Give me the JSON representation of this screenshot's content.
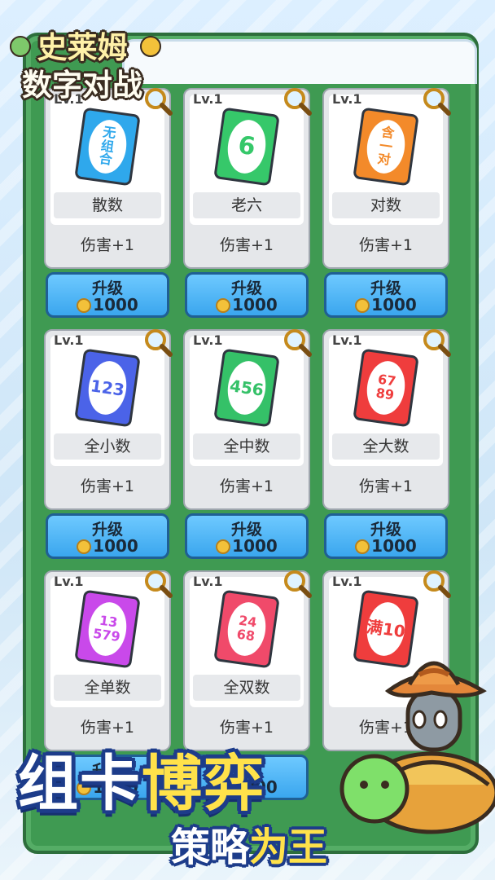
{
  "logo": {
    "line1": "史莱姆",
    "line2": "数字对战"
  },
  "cards": [
    {
      "level": "Lv.1",
      "card_text": "无\n组\n合",
      "name": "散数",
      "effect": "伤害+1",
      "color": "#2fa8ec",
      "upgrade": "升级",
      "cost": "1000",
      "icon": "magnifier-icon"
    },
    {
      "level": "Lv.1",
      "card_text": "6",
      "name": "老六",
      "effect": "伤害+1",
      "color": "#36c86a",
      "upgrade": "升级",
      "cost": "1000",
      "icon": "magnifier-icon"
    },
    {
      "level": "Lv.1",
      "card_text": "含\n一\n对",
      "name": "对数",
      "effect": "伤害+1",
      "color": "#f38a2a",
      "upgrade": "升级",
      "cost": "1000",
      "icon": "magnifier-icon"
    },
    {
      "level": "Lv.1",
      "card_text": "123",
      "name": "全小数",
      "effect": "伤害+1",
      "color": "#4b63e8",
      "upgrade": "升级",
      "cost": "1000",
      "icon": "magnifier-icon"
    },
    {
      "level": "Lv.1",
      "card_text": "456",
      "name": "全中数",
      "effect": "伤害+1",
      "color": "#35c168",
      "upgrade": "升级",
      "cost": "1000",
      "icon": "magnifier-icon"
    },
    {
      "level": "Lv.1",
      "card_text": "67\n89",
      "name": "全大数",
      "effect": "伤害+1",
      "color": "#ef3d3d",
      "upgrade": "升级",
      "cost": "1000",
      "icon": "magnifier-icon"
    },
    {
      "level": "Lv.1",
      "card_text": "13\n579",
      "name": "全单数",
      "effect": "伤害+1",
      "color": "#c949ea",
      "upgrade": "升级",
      "cost": "1000",
      "icon": "magnifier-icon"
    },
    {
      "level": "Lv.1",
      "card_text": "24\n68",
      "name": "全双数",
      "effect": "伤害+1",
      "color": "#f04a6a",
      "upgrade": "升级",
      "cost": "1000",
      "icon": "magnifier-icon"
    },
    {
      "level": "Lv.1",
      "card_text": "满10",
      "name": "",
      "effect": "伤害+1",
      "color": "#ef3d3d",
      "upgrade": "",
      "cost": "",
      "icon": "magnifier-icon"
    }
  ],
  "banner": {
    "main_white": "组卡",
    "main_yellow": "博弈",
    "sub_white": "策略",
    "sub_yellow": "为王"
  }
}
